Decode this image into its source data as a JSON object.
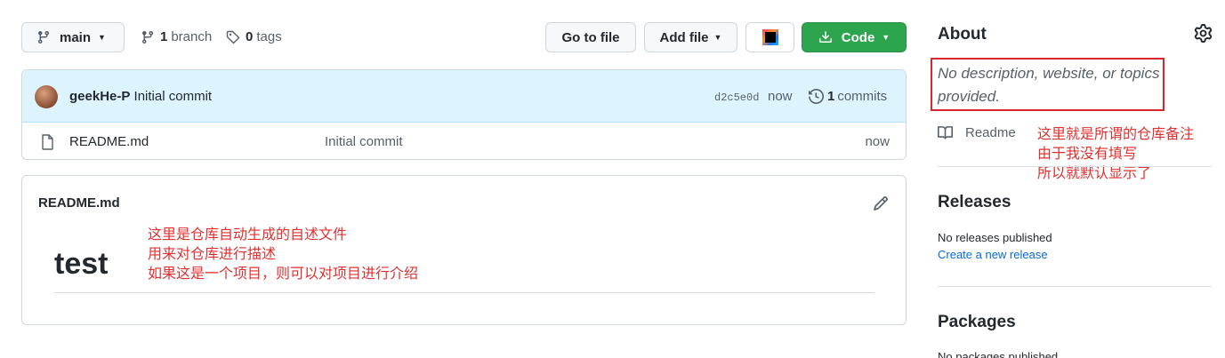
{
  "toolbar": {
    "branch_label": "main",
    "branches_count": "1",
    "branches_label": "branch",
    "tags_count": "0",
    "tags_label": "tags",
    "go_to_file_label": "Go to file",
    "add_file_label": "Add file",
    "code_label": "Code",
    "ide_icon": "jetbrains-ide-icon"
  },
  "latest_commit": {
    "author": "geekHe-P",
    "message": "Initial commit",
    "sha": "d2c5e0d",
    "time": "now",
    "commits_count": "1",
    "commits_label": "commits"
  },
  "files": [
    {
      "name": "README.md",
      "message": "Initial commit",
      "time": "now"
    }
  ],
  "readme": {
    "title": "README.md",
    "heading": "test",
    "annotation_lines": [
      "这里是仓库自动生成的自述文件",
      "用来对仓库进行描述",
      "如果这是一个项目，则可以对项目进行介绍"
    ]
  },
  "about": {
    "title": "About",
    "description": "No description, website, or topics provided.",
    "readme_label": "Readme",
    "annotation_lines": [
      "这里就是所谓的仓库备注",
      "由于我没有填写",
      "所以就默认显示了"
    ]
  },
  "releases": {
    "title": "Releases",
    "empty_text": "No releases published",
    "create_link": "Create a new release"
  },
  "packages": {
    "title": "Packages",
    "empty_text": "No packages published"
  },
  "colors": {
    "code_button": "#2da44e",
    "commit_header_bg": "#ddf4ff",
    "annotation_red": "#e03030",
    "link_blue": "#0969da"
  }
}
